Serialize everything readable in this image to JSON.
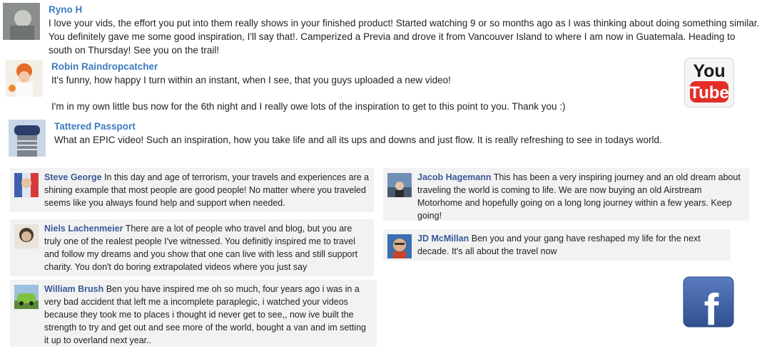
{
  "youtube_comments": [
    {
      "name": "Ryno H",
      "text": "I love your vids, the effort you put into them really shows in your finished product!  Started watching 9 or so months ago as I was thinking about doing something similar.  You definitely gave me some good inspiration, I'll say that!.  Camperized a Previa and drove it from Vancouver Island to where I am now in Guatemala.  Heading to south on Thursday!  See you on the trail!"
    },
    {
      "name": "Robin Raindropcatcher",
      "text": "It's funny, how happy I turn within an instant, when I see, that you guys uploaded a new video!",
      "text2": "I'm in my own little bus now for the 6th night and I really owe lots of the inspiration to get to this point to you. Thank you :)"
    },
    {
      "name": "Tattered Passport",
      "text": "What an EPIC video! Such an inspiration, how you take life and all its ups and downs and just flow. It is really refreshing to see in todays world."
    }
  ],
  "facebook_comments": [
    {
      "name": "Steve George",
      "text": "In this day and age of terrorism, your travels and experiences are a shining example that most people are good people! No matter where you traveled seems like you always found help and support when needed."
    },
    {
      "name": "Niels Lachenmeier",
      "text": "There are a lot of people who travel and blog, but you are truly one of the realest people I've witnessed. You definitly inspired me to travel and follow my dreams and you show that one can live with less and still support charity. You don't do boring extrapolated videos where you just say"
    },
    {
      "name": "William Brush",
      "text": "Ben you have inspired me oh so much, four years ago i was in a very bad accident that left me a incomplete paraplegic, i watched your videos because they took me to places i thought id never get to see,, now ive built the strength to try and get out and see more of the world, bought a van and im setting it up to overland next year.."
    },
    {
      "name": "Jacob Hagemann",
      "text": "This has been a very inspiring journey and an old dream about traveling the world is coming to life. We are now buying an old Airstream Motorhome and hopefully going on a long long journey within a few years. Keep going!"
    },
    {
      "name": "JD McMillan",
      "text": "Ben you and your gang have reshaped my life for the next decade. It's all about the travel now"
    }
  ],
  "logos": {
    "youtube_top": "You",
    "youtube_bottom": "Tube",
    "facebook": "f"
  },
  "colors": {
    "youtube_name": "#3d7bbf",
    "facebook_name": "#3b5998",
    "facebook_bg": "#f2f2f2",
    "youtube_red": "#e52d27",
    "facebook_blue": "#3b5998"
  }
}
